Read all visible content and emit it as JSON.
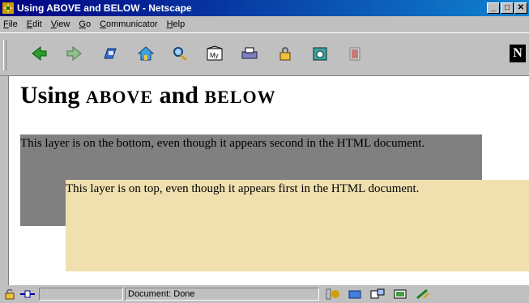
{
  "window": {
    "title": "Using ABOVE and BELOW - Netscape",
    "minimize": "_",
    "maximize": "□",
    "close": "✕"
  },
  "menu": [
    {
      "label": "File",
      "ul": "F",
      "rest": "ile"
    },
    {
      "label": "Edit",
      "ul": "E",
      "rest": "dit"
    },
    {
      "label": "View",
      "ul": "V",
      "rest": "iew"
    },
    {
      "label": "Go",
      "ul": "G",
      "rest": "o"
    },
    {
      "label": "Communicator",
      "ul": "C",
      "rest": "ommunicator"
    },
    {
      "label": "Help",
      "ul": "H",
      "rest": "elp"
    }
  ],
  "toolbar": {
    "icons": [
      "back-icon",
      "forward-icon",
      "reload-icon",
      "home-icon",
      "search-icon",
      "my-netscape-icon",
      "print-icon",
      "security-icon",
      "shop-icon",
      "stop-icon"
    ],
    "my_label": "My",
    "logo": "N"
  },
  "page": {
    "heading_word1": "Using ",
    "heading_word2": "ABOVE",
    "heading_word3": " and ",
    "heading_word4": "BELOW",
    "layer_bottom_text": "This layer is on the bottom, even though it appears second in the HTML document.",
    "layer_top_text": "This layer is on top, even though it appears first in the HTML document."
  },
  "status": {
    "text": "Document: Done"
  },
  "colors": {
    "titlebar": "#000080",
    "bottom_layer": "#808080",
    "top_layer": "#f0e0b0"
  }
}
